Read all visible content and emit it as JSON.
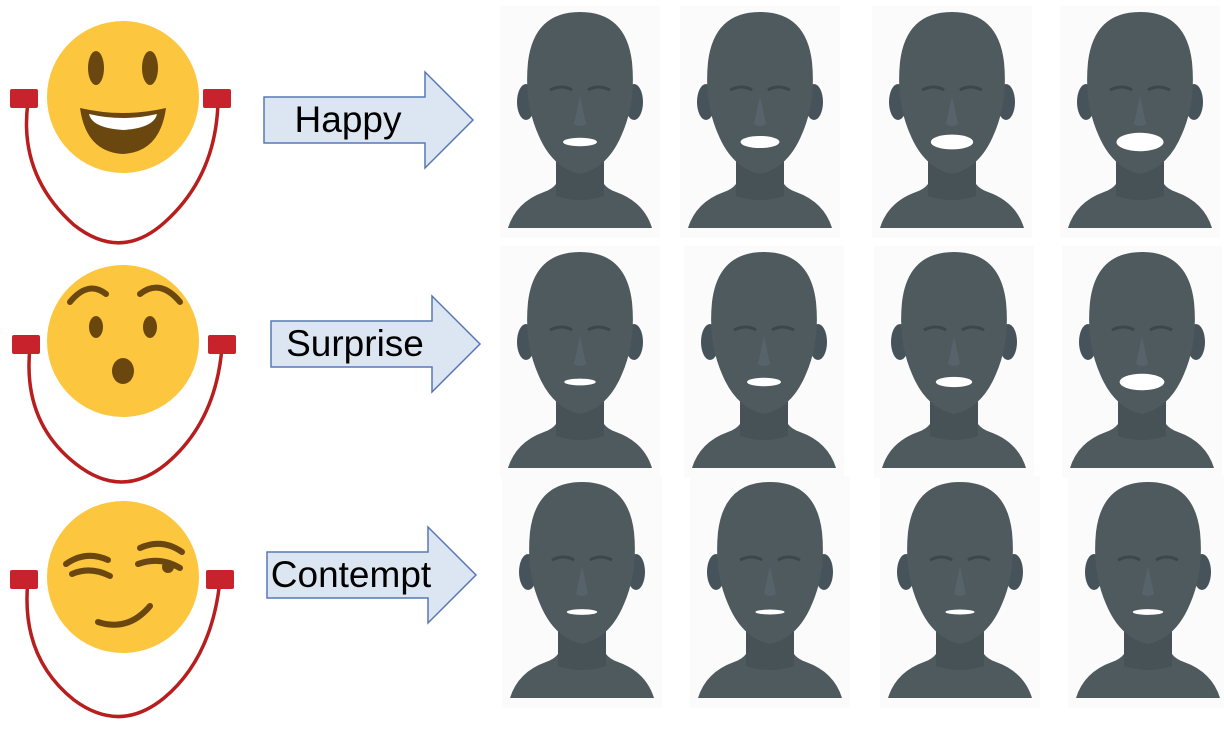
{
  "rows": [
    {
      "expression": "Happy",
      "emoji_icon": "grinning-face-icon",
      "mouth_openness": [
        0.25,
        0.45,
        0.6,
        0.8
      ]
    },
    {
      "expression": "Surprise",
      "emoji_icon": "hushed-face-icon",
      "mouth_openness": [
        0.15,
        0.25,
        0.35,
        0.7
      ]
    },
    {
      "expression": "Contempt",
      "emoji_icon": "smirking-face-icon",
      "mouth_openness": [
        0.1,
        0.05,
        0.05,
        0.1
      ]
    }
  ],
  "colors": {
    "emoji_face": "#FCC63F",
    "emoji_feature": "#6B4710",
    "headphone_cord": "#B81E1E",
    "arrow_fill": "#DCE6F3",
    "arrow_stroke": "#5778B5",
    "head_mesh": "#4E5A5E",
    "teeth": "#FFFFFF"
  }
}
